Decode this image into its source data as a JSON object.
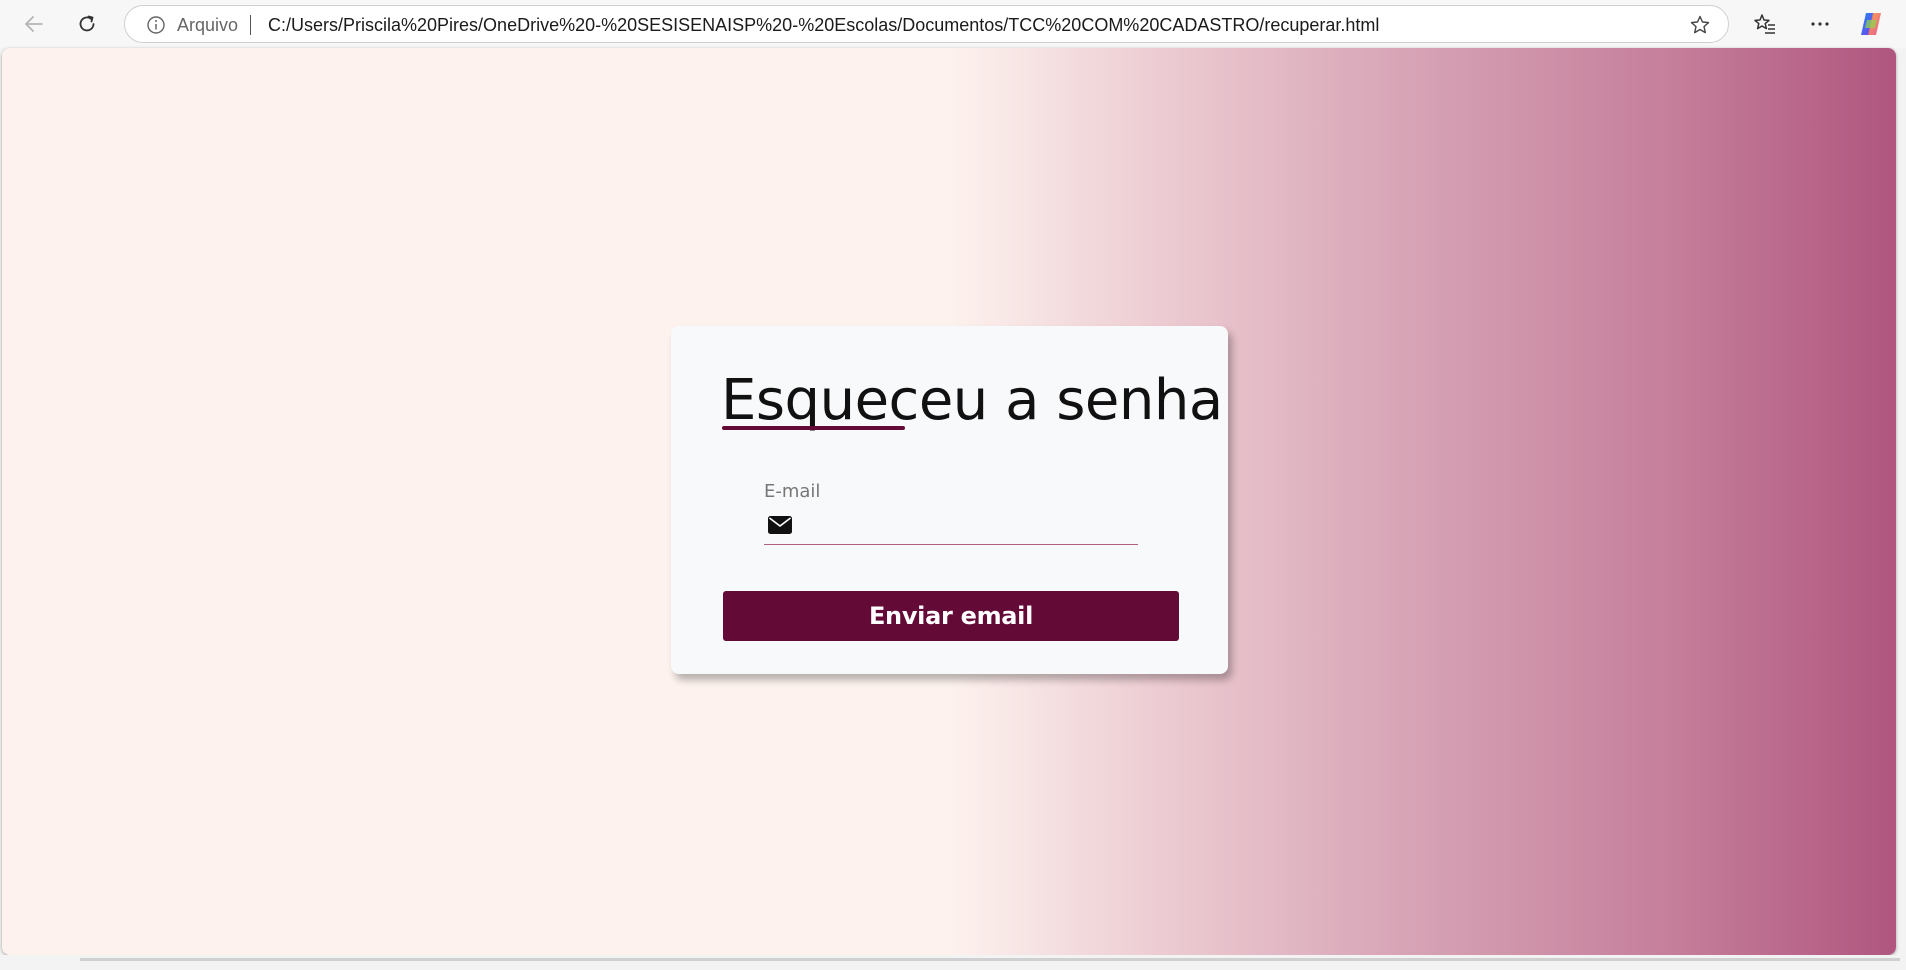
{
  "browser": {
    "site_label": "Arquivo",
    "url": "C:/Users/Priscila%20Pires/OneDrive%20-%20SESISENAISP%20-%20Escolas/Documentos/TCC%20COM%20CADASTRO/recuperar.html",
    "icons": [
      "back-arrow-icon",
      "reload-icon",
      "info-icon",
      "star-icon",
      "favorites-icon",
      "more-icon",
      "copilot-icon"
    ]
  },
  "page": {
    "title": "Esqueceu a senha",
    "email_label": "E-mail",
    "email_value": "",
    "submit_label": "Enviar email",
    "icons": [
      "envelope-icon"
    ]
  },
  "colors": {
    "accent": "#640a36",
    "card_bg": "#f8f9fa",
    "background_left": "#fdf2ee",
    "background_right": "#b0567f"
  }
}
